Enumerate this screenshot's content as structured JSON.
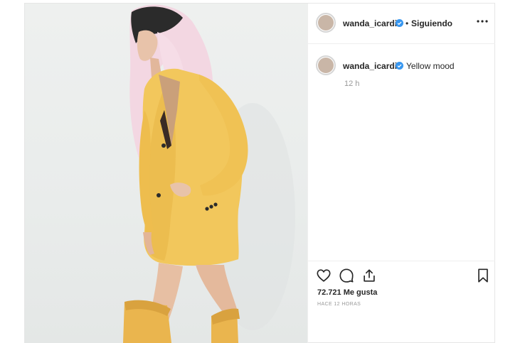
{
  "post": {
    "author": {
      "username": "wanda_icardi",
      "verified_icon": "verified-badge-icon",
      "separator": "•",
      "follow_status": "Siguiendo"
    },
    "more_icon": "more-options-icon",
    "caption": {
      "username": "wanda_icardi",
      "text": "Yellow mood",
      "time": "12 h"
    },
    "actions": {
      "like_icon": "heart-icon",
      "comment_icon": "comment-icon",
      "share_icon": "share-icon",
      "save_icon": "bookmark-icon"
    },
    "likes_text": "72.721 Me gusta",
    "timestamp": "HACE 12 HORAS"
  },
  "colors": {
    "verified": "#3897f0",
    "text": "#262626",
    "muted": "#999999",
    "border": "#efefef",
    "jacket": "#f2c75c"
  }
}
